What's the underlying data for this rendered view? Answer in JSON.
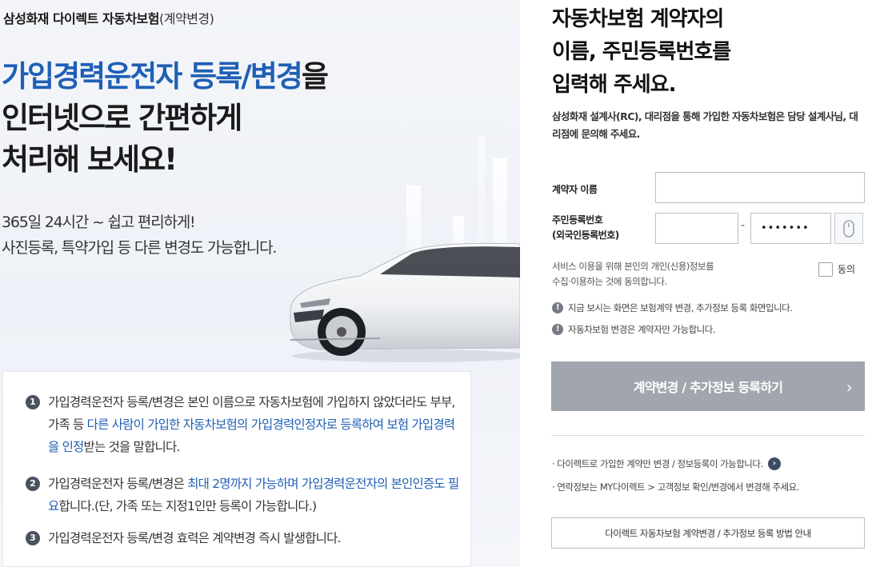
{
  "left": {
    "brand_bold": "삼성화재 다이렉트 자동차보험",
    "brand_light": "(계약변경)",
    "headline": {
      "line1_highlight": "가입경력운전자 등록/변경",
      "line1_rest": "을",
      "line2": "인터넷으로 간편하게",
      "line3": "처리해 보세요!"
    },
    "subline": {
      "line1": "365일 24시간 ~ 쉽고 편리하게!",
      "line2": "사진등록, 특약가입 등 다른 변경도 가능합니다."
    },
    "info_items": [
      {
        "num": "1",
        "text_a": "가입경력운전자 등록/변경은 본인 이름으로 자동차보험에 가입하지 않았더라도 부부, 가족 등 ",
        "text_blue": "다른 사람이 가입한 자동차보험의 가입경력인정자로 등록하여 보험 가입경력을 인정",
        "text_b": "받는 것을 말합니다."
      },
      {
        "num": "2",
        "text_a": "가입경력운전자 등록/변경은 ",
        "text_blue": "최대 2명까지 가능하며 가입경력운전자의 본인인증도 필요",
        "text_b": "합니다.(단, 가족 또는 지정1인만 등록이 가능합니다.)"
      },
      {
        "num": "3",
        "text_a": "가입경력운전자 등록/변경 효력은 계약변경 즉시 발생합니다.",
        "text_blue": "",
        "text_b": ""
      }
    ]
  },
  "right": {
    "title": {
      "line1": "자동차보험 계약자의",
      "line2": "이름, 주민등록번호를",
      "line3": "입력해 주세요."
    },
    "description": "삼성화재 설계사(RC), 대리점을 통해 가입한 자동차보험은 담당 설계사님, 대리점에 문의해 주세요.",
    "form": {
      "name_label": "계약자 이름",
      "name_value": "",
      "rrn_label_line1": "주민등록번호",
      "rrn_label_line2": "(외국인등록번호)",
      "rrn_front_value": "",
      "rrn_dash": "-",
      "rrn_back_value": "•••••••",
      "mouse_icon": "mouse-icon"
    },
    "consent": {
      "line1": "서비스 이용을 위해 본인의 개인(신용)정보를",
      "line2": "수집·이용하는 것에 동의합니다.",
      "checkbox_label": "동의",
      "checked": false
    },
    "notices": [
      "지금 보시는 화면은 보험계약 변경, 추가정보 등록 화면입니다.",
      "자동차보험 변경은 계약자만 가능합니다."
    ],
    "submit_label": "계약변경 / 추가정보 등록하기",
    "submit_chevron": "›",
    "bullets": [
      "· 다이렉트로 가입한 계약만 변경 / 정보등록이 가능합니다.",
      "· 연락정보는 MY다이렉트 > 고객정보 확인/변경에서 변경해 주세요."
    ],
    "bullet_arrow": "›",
    "guide_button_label": "다이렉트 자동차보험 계약변경 / 추가정보 등록 방법 안내",
    "colors": {
      "accent_blue": "#1f5fb5",
      "submit_disabled": "#a1a5ad"
    }
  }
}
